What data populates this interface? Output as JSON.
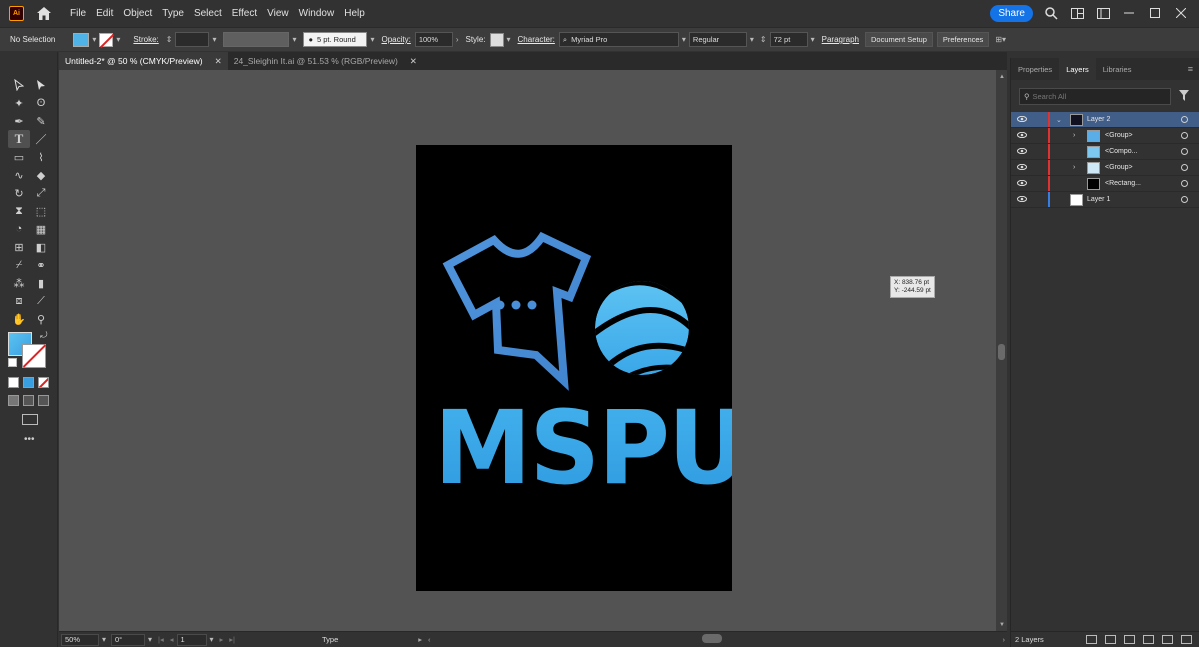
{
  "app": {
    "logo": "Ai"
  },
  "menu": [
    "File",
    "Edit",
    "Object",
    "Type",
    "Select",
    "Effect",
    "View",
    "Window",
    "Help"
  ],
  "share_label": "Share",
  "control": {
    "selection": "No Selection",
    "stroke_label": "Stroke:",
    "brush": "5 pt. Round",
    "opacity_label": "Opacity:",
    "opacity": "100%",
    "style_label": "Style:",
    "character_label": "Character:",
    "font": "Myriad Pro",
    "font_style": "Regular",
    "font_size": "72 pt",
    "paragraph_label": "Paragraph",
    "doc_setup": "Document Setup",
    "preferences": "Preferences"
  },
  "tabs": [
    {
      "label": "Untitled-2* @ 50 % (CMYK/Preview)",
      "active": true
    },
    {
      "label": "24_Sleighin It.ai @ 51.53 % (RGB/Preview)",
      "active": false
    }
  ],
  "canvas": {
    "logo_text": "MSPU",
    "coord_x": "X: 838.76 pt",
    "coord_y": "Y: -244.59 pt"
  },
  "status": {
    "zoom": "50%",
    "rotation": "0°",
    "artboard": "1",
    "tool": "Type"
  },
  "panel": {
    "tabs": [
      "Properties",
      "Layers",
      "Libraries"
    ],
    "active_tab": "Layers",
    "search_placeholder": "Search All",
    "layers": [
      {
        "name": "Layer 2",
        "indent": 0,
        "color": "#d33",
        "selected": true,
        "expandable": true
      },
      {
        "name": "<Group>",
        "indent": 1,
        "color": "#d33",
        "selected": false,
        "expandable": true
      },
      {
        "name": "<Compo...",
        "indent": 1,
        "color": "#d33",
        "selected": false,
        "expandable": false
      },
      {
        "name": "<Group>",
        "indent": 1,
        "color": "#d33",
        "selected": false,
        "expandable": true
      },
      {
        "name": "<Rectang...",
        "indent": 1,
        "color": "#d33",
        "selected": false,
        "expandable": false
      },
      {
        "name": "Layer 1",
        "indent": 0,
        "color": "#3a7de0",
        "selected": false,
        "expandable": false
      }
    ],
    "footer": "2 Layers"
  },
  "colors": {
    "accent": "#1473e6",
    "logo_blue": "#3aa8e8",
    "shirt_blue": "#4a90d9"
  }
}
